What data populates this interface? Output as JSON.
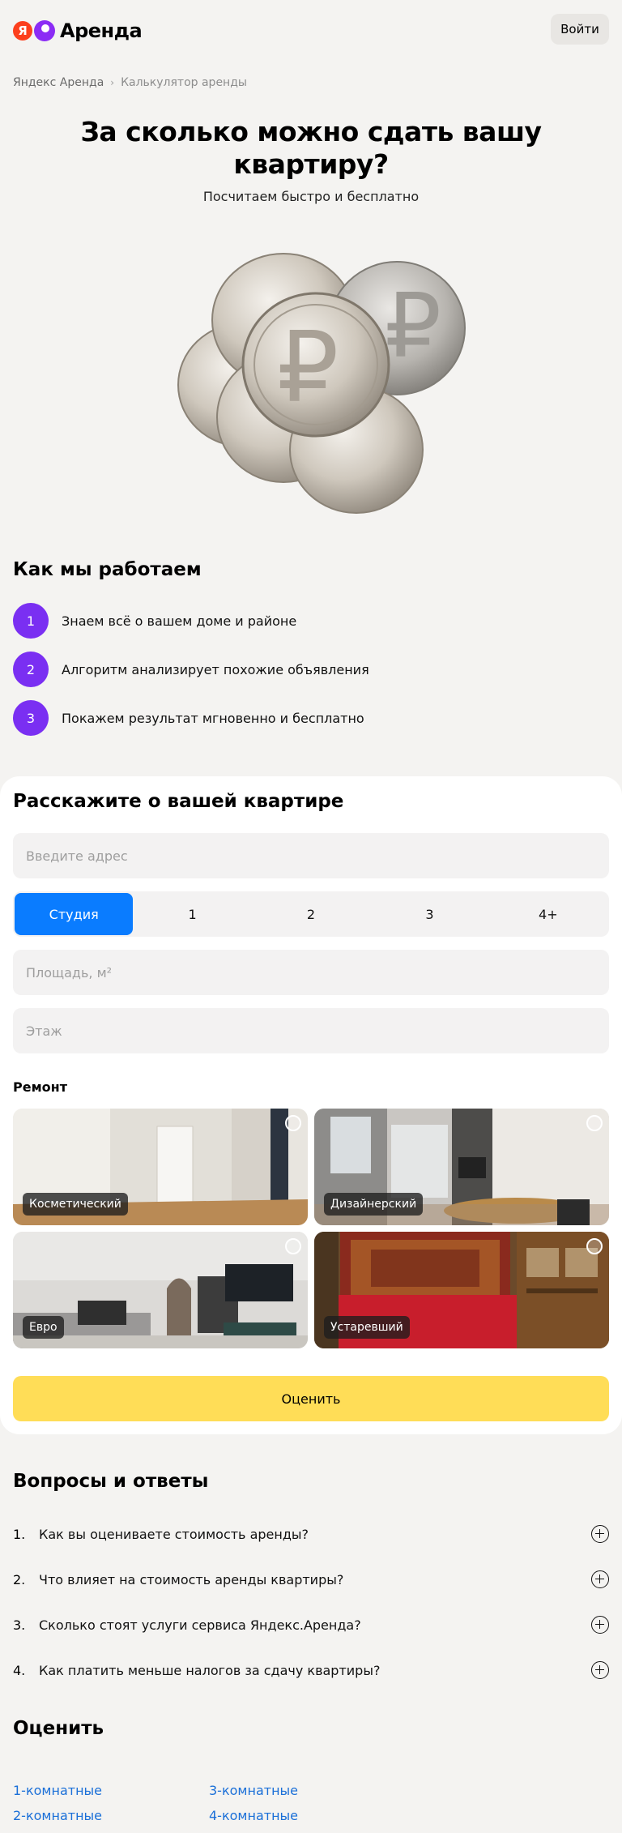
{
  "header": {
    "logo_letter": "Я",
    "logo_text": "Аренда",
    "login_label": "Войти"
  },
  "breadcrumb": {
    "items": [
      "Яндекс Аренда",
      "Калькулятор аренды"
    ],
    "separator": "›"
  },
  "hero": {
    "title": "За сколько можно сдать вашу квартиру?",
    "subtitle": "Посчитаем быстро и бесплатно",
    "coin_symbol": "₽"
  },
  "how": {
    "title": "Как мы работаем",
    "steps": [
      {
        "num": "1",
        "text": "Знаем всё о вашем доме и районе"
      },
      {
        "num": "2",
        "text": "Алгоритм анализирует похожие объявления"
      },
      {
        "num": "3",
        "text": "Покажем результат мгновенно и бесплатно"
      }
    ]
  },
  "form": {
    "title": "Расскажите о вашей квартире",
    "address_placeholder": "Введите адрес",
    "rooms": [
      "Студия",
      "1",
      "2",
      "3",
      "4+"
    ],
    "rooms_selected": "Студия",
    "area_placeholder": "Площадь, м²",
    "floor_placeholder": "Этаж",
    "repair_label": "Ремонт",
    "repair_options": [
      "Косметический",
      "Дизайнерский",
      "Евро",
      "Устаревший"
    ],
    "submit_label": "Оценить"
  },
  "faq": {
    "title": "Вопросы и ответы",
    "items": [
      {
        "num": "1.",
        "q": "Как вы оцениваете стоимость аренды?"
      },
      {
        "num": "2.",
        "q": "Что влияет на стоимость аренды квартиры?"
      },
      {
        "num": "3.",
        "q": "Сколько стоят услуги сервиса Яндекс.Аренда?"
      },
      {
        "num": "4.",
        "q": "Как платить меньше налогов за сдачу квартиры?"
      }
    ]
  },
  "evaluate": {
    "title": "Оценить",
    "links": [
      "1-комнатные",
      "3-комнатные",
      "2-комнатные",
      "4-комнатные"
    ]
  },
  "colors": {
    "accent_purple": "#7a2ff2",
    "accent_blue": "#0a7cff",
    "accent_yellow": "#ffdd57",
    "link_blue": "#1a6fd8",
    "brand_red": "#fc3f1d"
  }
}
